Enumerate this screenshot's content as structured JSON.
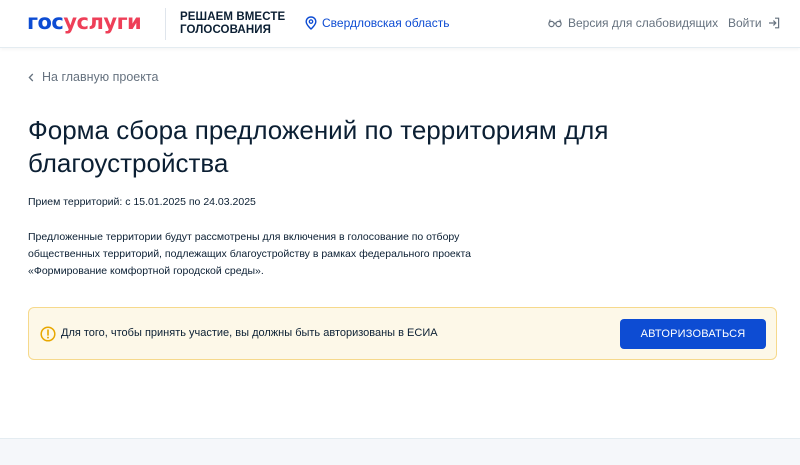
{
  "header": {
    "logo_part1": "гос",
    "logo_part2": "услуги",
    "tagline_line1": "РЕШАЕМ ВМЕСТЕ",
    "tagline_line2": "ГОЛОСОВАНИЯ",
    "region": "Свердловская область",
    "vision_label": "Версия для слабовидящих",
    "login_label": "Войти"
  },
  "main": {
    "back_label": "На главную проекта",
    "title": "Форма сбора предложений по территориям для благоустройства",
    "dates": "Прием территорий: с 15.01.2025 по 24.03.2025",
    "description": "Предложенные территории будут рассмотрены для включения в голосование по отбору общественных территорий, подлежащих благоустройству в рамках федерального проекта «Формирование комфортной городской среды».",
    "alert_text": "Для того, чтобы принять участие, вы должны быть авторизованы в ЕСИА",
    "auth_button": "АВТОРИЗОВАТЬСЯ"
  },
  "colors": {
    "brand_blue": "#0d4cd3",
    "brand_red": "#ee3f58",
    "alert_bg": "#fdf8e8",
    "alert_border": "#f6d98c",
    "alert_icon": "#e8a700"
  },
  "icons": {
    "region": "location-pin-icon",
    "vision": "glasses-icon",
    "login": "login-arrow-icon",
    "back": "chevron-left-icon",
    "alert": "warning-icon"
  }
}
